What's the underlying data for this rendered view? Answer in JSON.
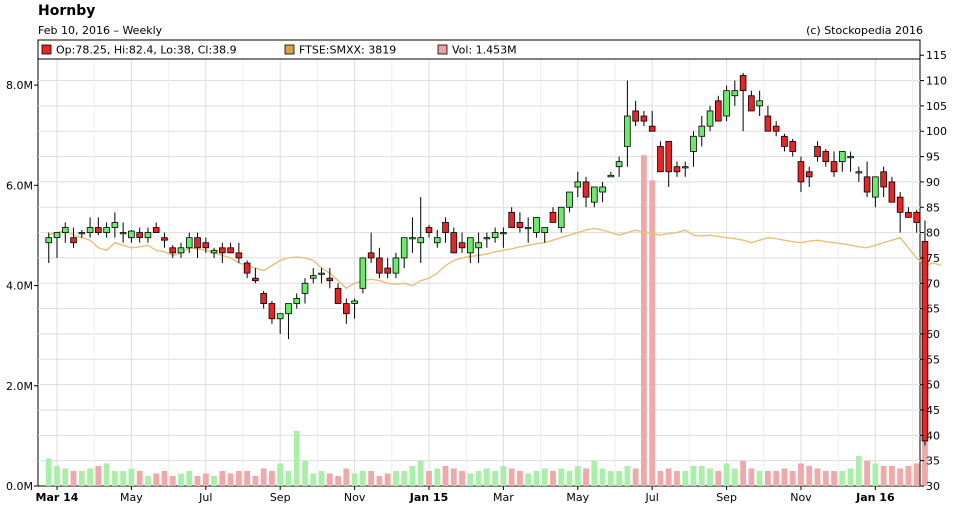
{
  "header": {
    "title": "Hornby",
    "subtitle": "Feb 10, 2016 – Weekly",
    "copyright": "(c) Stockopedia 2016"
  },
  "legend": {
    "ohlc": "Op:78.25, Hi:82.4, Lo:38, Cl:38.9",
    "index": "FTSE:SMXX: 3819",
    "volume": "Vol: 1.453M"
  },
  "colors": {
    "up": "#66ee66",
    "down": "#ee2222",
    "index_line": "#e8c07a",
    "vol_up": "#a8f0a8",
    "vol_down": "#f0a8a8",
    "grid": "#dddddd"
  },
  "chart_data": {
    "type": "candlestick",
    "x_tick_labels": [
      {
        "label": "Mar 14",
        "week": 1,
        "bold": true
      },
      {
        "label": "May",
        "week": 10,
        "bold": false
      },
      {
        "label": "Jul",
        "week": 19,
        "bold": false
      },
      {
        "label": "Sep",
        "week": 28,
        "bold": false
      },
      {
        "label": "Nov",
        "week": 37,
        "bold": false
      },
      {
        "label": "Jan 15",
        "week": 46,
        "bold": true
      },
      {
        "label": "Mar",
        "week": 55,
        "bold": false
      },
      {
        "label": "May",
        "week": 64,
        "bold": false
      },
      {
        "label": "Jul",
        "week": 73,
        "bold": false
      },
      {
        "label": "Sep",
        "week": 82,
        "bold": false
      },
      {
        "label": "Nov",
        "week": 91,
        "bold": false
      },
      {
        "label": "Jan 16",
        "week": 100,
        "bold": true
      }
    ],
    "x_range": [
      -1.3,
      105.4
    ],
    "price_axis": {
      "ticks": [
        30,
        35,
        40,
        45,
        50,
        55,
        60,
        65,
        70,
        75,
        80,
        85,
        90,
        95,
        100,
        105,
        110,
        115
      ],
      "range": [
        30,
        118
      ]
    },
    "volume_axis": {
      "ticks": [
        0,
        2,
        4,
        6,
        8
      ],
      "tick_labels": [
        "0.0M",
        "2.0M",
        "4.0M",
        "6.0M",
        "8.0M"
      ],
      "range": [
        0,
        8.9
      ]
    },
    "candles": [
      [
        78,
        80,
        74,
        79
      ],
      [
        79,
        80,
        75,
        80
      ],
      [
        80,
        82,
        78,
        81
      ],
      [
        79,
        81,
        77,
        78
      ],
      [
        80,
        80.5,
        79,
        80
      ],
      [
        80,
        83,
        79,
        81
      ],
      [
        81,
        83,
        79.5,
        80
      ],
      [
        80,
        82,
        79,
        81
      ],
      [
        81,
        84,
        79,
        82
      ],
      [
        80,
        82,
        78,
        80
      ],
      [
        79,
        80.5,
        78,
        80.3
      ],
      [
        80,
        81,
        78,
        79
      ],
      [
        79,
        81,
        78,
        80
      ],
      [
        81,
        82,
        80,
        80
      ],
      [
        79,
        80,
        77,
        78.5
      ],
      [
        77,
        77.5,
        75,
        76
      ],
      [
        76,
        78,
        75,
        77
      ],
      [
        77,
        80,
        76,
        79
      ],
      [
        79,
        80,
        75,
        77
      ],
      [
        78,
        79,
        76,
        77
      ],
      [
        76,
        77,
        75,
        76.5
      ],
      [
        77,
        78,
        74,
        76
      ],
      [
        77,
        78,
        76,
        76
      ],
      [
        76,
        78,
        74,
        75
      ],
      [
        74,
        74.5,
        71,
        72
      ],
      [
        71,
        73,
        70,
        70.5
      ],
      [
        68,
        68.5,
        65,
        66
      ],
      [
        66,
        66.5,
        62,
        63
      ],
      [
        63,
        64,
        60,
        64
      ],
      [
        64,
        66,
        59,
        66
      ],
      [
        66,
        68,
        65,
        67
      ],
      [
        68,
        71,
        66,
        70
      ],
      [
        71,
        73,
        70,
        71.5
      ],
      [
        72,
        73,
        70,
        72
      ],
      [
        71,
        73,
        69,
        70.5
      ],
      [
        69,
        70,
        66,
        66
      ],
      [
        66,
        67,
        62,
        64
      ],
      [
        66,
        67,
        63,
        66.5
      ],
      [
        69,
        75,
        68,
        75
      ],
      [
        76,
        80,
        74,
        75
      ],
      [
        75,
        77,
        71,
        72
      ],
      [
        73,
        75,
        71,
        72
      ],
      [
        72,
        76,
        71,
        75
      ],
      [
        75,
        78,
        73,
        79
      ],
      [
        79,
        83,
        76,
        79
      ],
      [
        78,
        87,
        74,
        79
      ],
      [
        81,
        81.5,
        79,
        80
      ],
      [
        78,
        80.5,
        77,
        79
      ],
      [
        82,
        83,
        78,
        80
      ],
      [
        80,
        81,
        76,
        76
      ],
      [
        78,
        80,
        76,
        77
      ],
      [
        76,
        78,
        74,
        79
      ],
      [
        77,
        80,
        74,
        78
      ],
      [
        79,
        80,
        77,
        79
      ],
      [
        79,
        81,
        78,
        80
      ],
      [
        80,
        81,
        77,
        80
      ],
      [
        84,
        85,
        81,
        81
      ],
      [
        82,
        84,
        80,
        81
      ],
      [
        81,
        83,
        78,
        81
      ],
      [
        80,
        83,
        79,
        83
      ],
      [
        80,
        81,
        78,
        81
      ],
      [
        84,
        85,
        82,
        82
      ],
      [
        81,
        83,
        80,
        85
      ],
      [
        85,
        87,
        84,
        88
      ],
      [
        89,
        92,
        87,
        90
      ],
      [
        90,
        91,
        85,
        87
      ],
      [
        86,
        89,
        85,
        89
      ],
      [
        88,
        90,
        86,
        89
      ],
      [
        91,
        92,
        91,
        91.3
      ],
      [
        93,
        95,
        91,
        94
      ],
      [
        97,
        110,
        93,
        103
      ],
      [
        104,
        106,
        101,
        102
      ],
      [
        103,
        104,
        101,
        102
      ],
      [
        101,
        104,
        100,
        100
      ],
      [
        97,
        98,
        92,
        92
      ],
      [
        98,
        95,
        89,
        92
      ],
      [
        93,
        94,
        91,
        92
      ],
      [
        93,
        94,
        91,
        93
      ],
      [
        96,
        100,
        93,
        99
      ],
      [
        99,
        103,
        97,
        101
      ],
      [
        101,
        105,
        100,
        104
      ],
      [
        106,
        107,
        102,
        102
      ],
      [
        103,
        109,
        102,
        108
      ],
      [
        107,
        110,
        105,
        108
      ],
      [
        111,
        111.5,
        100,
        108
      ],
      [
        107,
        108,
        104,
        104
      ],
      [
        105,
        108,
        103,
        106
      ],
      [
        103,
        105,
        100,
        100
      ],
      [
        101,
        102,
        99,
        100
      ],
      [
        99,
        99.5,
        96,
        97
      ],
      [
        98,
        98.5,
        95,
        96
      ],
      [
        94,
        95,
        88,
        90
      ],
      [
        92,
        93,
        89,
        91
      ],
      [
        97,
        98,
        94,
        95
      ],
      [
        96,
        96.5,
        93,
        94
      ],
      [
        94,
        96,
        91,
        92
      ],
      [
        94,
        95,
        92,
        96
      ],
      [
        95,
        96,
        92,
        95
      ],
      [
        92,
        93,
        90,
        92
      ],
      [
        91,
        94,
        87,
        88
      ],
      [
        87,
        89,
        85,
        91
      ],
      [
        92,
        93,
        87,
        89
      ],
      [
        90,
        91,
        86,
        86
      ],
      [
        87,
        88,
        80,
        84
      ],
      [
        84,
        85,
        83,
        83
      ],
      [
        84,
        84.5,
        80,
        82
      ],
      [
        78.25,
        82.4,
        38,
        38.9
      ]
    ],
    "index_line": [
      79.5,
      80,
      80.5,
      79.5,
      79,
      78.5,
      77,
      76.5,
      78,
      77.5,
      77,
      77.2,
      77.5,
      76.5,
      76.2,
      75.5,
      76,
      77,
      76.8,
      76.5,
      76,
      75.5,
      75,
      74,
      73.5,
      73,
      72.5,
      73.5,
      74.5,
      75,
      75.2,
      75,
      74.5,
      73,
      72,
      70.5,
      69,
      70,
      70.5,
      70.8,
      70.5,
      70,
      69.8,
      70,
      69.5,
      70.5,
      71,
      72,
      73.5,
      74.5,
      75,
      75.3,
      75.5,
      75.8,
      76.2,
      76.5,
      76.8,
      77.2,
      77.5,
      77.8,
      78,
      78.5,
      79,
      79.5,
      80,
      80.5,
      80.8,
      80.5,
      80,
      79.5,
      80,
      80.5,
      80,
      79.8,
      79.5,
      79.8,
      80,
      80.5,
      79.5,
      79.3,
      79.5,
      79.2,
      79,
      78.8,
      78.5,
      78,
      78.5,
      79,
      78.8,
      78.5,
      78.2,
      78,
      78.3,
      78.5,
      78.2,
      78,
      77.8,
      77.5,
      77.2,
      77,
      77.5,
      78,
      78.5,
      79,
      77,
      75,
      73.5,
      74,
      73.5
    ],
    "volume": [
      0.55,
      0.4,
      0.35,
      0.3,
      0.3,
      0.35,
      0.4,
      0.45,
      0.3,
      0.3,
      0.35,
      0.3,
      0.2,
      0.25,
      0.3,
      0.2,
      0.25,
      0.3,
      0.2,
      0.25,
      0.2,
      0.3,
      0.25,
      0.3,
      0.3,
      0.2,
      0.35,
      0.3,
      0.45,
      0.3,
      1.1,
      0.5,
      0.25,
      0.3,
      0.25,
      0.2,
      0.35,
      0.25,
      0.3,
      0.3,
      0.2,
      0.25,
      0.3,
      0.3,
      0.4,
      0.5,
      0.3,
      0.35,
      0.4,
      0.35,
      0.3,
      0.25,
      0.3,
      0.35,
      0.3,
      0.4,
      0.35,
      0.3,
      0.25,
      0.3,
      0.35,
      0.3,
      0.35,
      0.3,
      0.4,
      0.35,
      0.5,
      0.35,
      0.3,
      0.3,
      0.4,
      0.35,
      6.6,
      6.1,
      0.3,
      0.35,
      0.3,
      0.3,
      0.4,
      0.4,
      0.35,
      0.3,
      0.45,
      0.35,
      0.5,
      0.35,
      0.3,
      0.3,
      0.3,
      0.35,
      0.3,
      0.45,
      0.4,
      0.35,
      0.3,
      0.3,
      0.3,
      0.35,
      0.6,
      0.5,
      0.45,
      0.4,
      0.4,
      0.35,
      0.4,
      0.45,
      1.453
    ]
  }
}
